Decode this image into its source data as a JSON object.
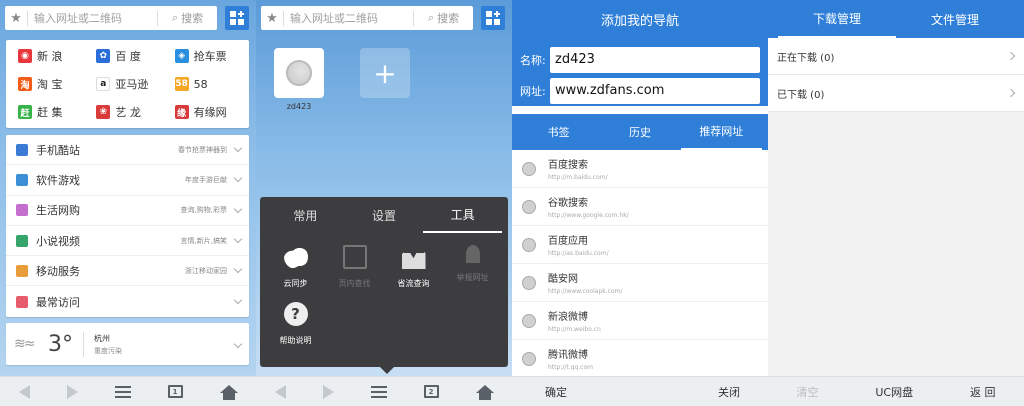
{
  "search": {
    "placeholder": "输入网址或二维码",
    "button_label": "搜索"
  },
  "quick_sites": [
    {
      "label": "新 浪",
      "icon": "sina-icon",
      "color": "#e8363d",
      "glyph": "◉"
    },
    {
      "label": "百 度",
      "icon": "baidu-icon",
      "color": "#2b6ed9",
      "glyph": "✿"
    },
    {
      "label": "抢车票",
      "icon": "train-ticket-icon",
      "color": "#2b8fe0",
      "glyph": "◈"
    },
    {
      "label": "淘 宝",
      "icon": "taobao-icon",
      "color": "#f25b18",
      "glyph": "淘"
    },
    {
      "label": "亚马逊",
      "icon": "amazon-icon",
      "color": "#ffffff",
      "glyph": "a"
    },
    {
      "label": "58",
      "icon": "58-icon",
      "color": "#f5a623",
      "glyph": "58"
    },
    {
      "label": "赶 集",
      "icon": "ganji-icon",
      "color": "#37b34a",
      "glyph": "赶"
    },
    {
      "label": "艺 龙",
      "icon": "elong-icon",
      "color": "#d93b3b",
      "glyph": "❀"
    },
    {
      "label": "有缘网",
      "icon": "youyuan-icon",
      "color": "#d73a3a",
      "glyph": "缘"
    }
  ],
  "categories": [
    {
      "label": "手机酷站",
      "sub": "春节抢票神器到",
      "color": "#3a7bd5"
    },
    {
      "label": "软件游戏",
      "sub": "年度手游巨献",
      "color": "#3a8fd5"
    },
    {
      "label": "生活网购",
      "sub": "查询,购物,彩票",
      "color": "#c46fd0"
    },
    {
      "label": "小说视频",
      "sub": "言情,新片,搞笑",
      "color": "#36a56a"
    },
    {
      "label": "移动服务",
      "sub": "浙江移动家园",
      "color": "#e89d3a"
    },
    {
      "label": "最常访问",
      "sub": "",
      "color": "#e85b6a"
    }
  ],
  "weather": {
    "temp": "3°",
    "city": "杭州",
    "air": "重度污染"
  },
  "nav_tile": {
    "label": "zd423",
    "add": "+"
  },
  "tools_menu": {
    "tabs": [
      "常用",
      "设置",
      "工具"
    ],
    "items": [
      {
        "label": "云同步",
        "icon": "cloud-sync-icon",
        "enabled": true
      },
      {
        "label": "页内查找",
        "icon": "find-in-page-icon",
        "enabled": false
      },
      {
        "label": "省流查询",
        "icon": "traffic-query-icon",
        "enabled": true
      },
      {
        "label": "举报网址",
        "icon": "report-url-icon",
        "enabled": false
      },
      {
        "label": "帮助说明",
        "icon": "help-icon",
        "enabled": true,
        "glyph": "?"
      }
    ]
  },
  "add_nav": {
    "title": "添加我的导航",
    "name_label": "名称:",
    "name_value": "zd423",
    "url_label": "网址:",
    "url_value": "www.zdfans.com",
    "tabs": [
      "书签",
      "历史",
      "推荐网址"
    ],
    "sites": [
      {
        "name": "百度搜索",
        "url": "http://m.baidu.com/"
      },
      {
        "name": "谷歌搜索",
        "url": "http://www.google.com.hk/"
      },
      {
        "name": "百度应用",
        "url": "http://as.baidu.com/"
      },
      {
        "name": "酷安网",
        "url": "http://www.coolapk.com/"
      },
      {
        "name": "新浪微博",
        "url": "http://m.weibo.cn"
      },
      {
        "name": "腾讯微博",
        "url": "http://t.qq.com"
      }
    ],
    "confirm": "确定",
    "close": "关闭"
  },
  "downloads": {
    "tabs": [
      "下载管理",
      "文件管理"
    ],
    "items": [
      "正在下载 (0)",
      "已下载 (0)"
    ],
    "bottom": [
      "清空",
      "UC网盘",
      "返 回"
    ]
  },
  "toolbar": {
    "tab_count": "1",
    "tab_count_2": "2"
  }
}
